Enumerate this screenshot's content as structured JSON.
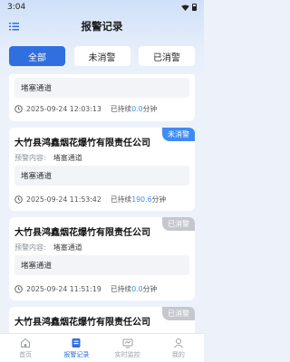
{
  "status_bar": {
    "time": "3:04"
  },
  "header": {
    "title": "报警记录"
  },
  "tabs": [
    {
      "label": "全部",
      "active": true
    },
    {
      "label": "未消警",
      "active": false
    },
    {
      "label": "已消警",
      "active": false
    }
  ],
  "cards": [
    {
      "content": "堵塞通道",
      "time": "2025-09-24 12:03:13",
      "duration_prefix": "已持续",
      "duration_value": "0.0",
      "duration_unit": "分钟"
    },
    {
      "company": "大竹县鸿鑫烟花爆竹有限责任公司",
      "badge": "未消警",
      "warn_label": "预警内容:",
      "warn_value": "堵塞通道",
      "content": "堵塞通道",
      "time": "2025-09-24 11:53:42",
      "duration_prefix": "已持续",
      "duration_value": "190.6",
      "duration_unit": "分钟"
    },
    {
      "company": "大竹县鸿鑫烟花爆竹有限责任公司",
      "badge": "已消警",
      "warn_label": "预警内容:",
      "warn_value": "堵塞通道",
      "content": "堵塞通道",
      "time": "2025-09-24 11:51:19",
      "duration_prefix": "已持续",
      "duration_value": "0.0",
      "duration_unit": "分钟"
    },
    {
      "company": "大竹县鸿鑫烟花爆竹有限责任公司",
      "badge": "已消警"
    }
  ],
  "nav": [
    {
      "label": "首页",
      "icon": "home-icon",
      "active": false
    },
    {
      "label": "报警记录",
      "icon": "alarm-record-icon",
      "active": true
    },
    {
      "label": "实时监控",
      "icon": "monitor-icon",
      "active": false
    },
    {
      "label": "我的",
      "icon": "user-icon",
      "active": false
    }
  ],
  "colors": {
    "accent": "#2f6fe0",
    "badge_unresolved": "#3f8bf3",
    "badge_resolved": "#c4c7cd"
  }
}
